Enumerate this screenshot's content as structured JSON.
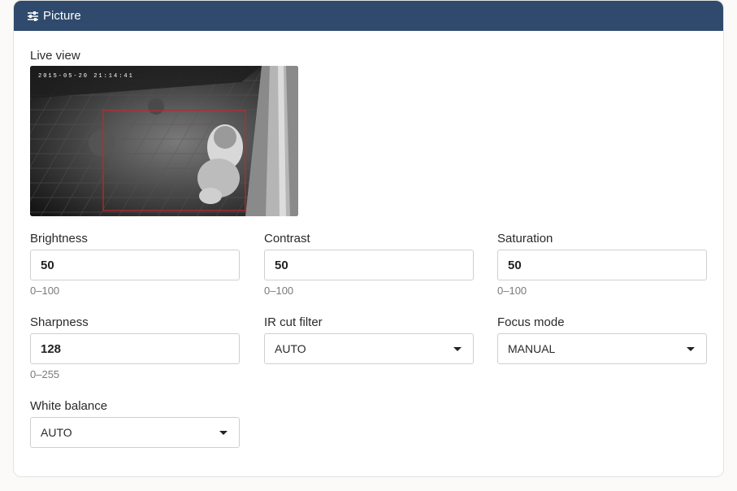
{
  "panel": {
    "title": "Picture",
    "icon": "sliders-icon"
  },
  "live_view": {
    "label": "Live view",
    "timestamp": "2015-05-20 21:14:41"
  },
  "fields": {
    "brightness": {
      "label": "Brightness",
      "value": "50",
      "hint": "0–100"
    },
    "contrast": {
      "label": "Contrast",
      "value": "50",
      "hint": "0–100"
    },
    "saturation": {
      "label": "Saturation",
      "value": "50",
      "hint": "0–100"
    },
    "sharpness": {
      "label": "Sharpness",
      "value": "128",
      "hint": "0–255"
    },
    "ir_cut_filter": {
      "label": "IR cut filter",
      "value": "AUTO"
    },
    "focus_mode": {
      "label": "Focus mode",
      "value": "MANUAL"
    },
    "white_balance": {
      "label": "White balance",
      "value": "AUTO"
    }
  },
  "colors": {
    "header": "#2f4a6c",
    "detection_box": "#c0282e"
  }
}
